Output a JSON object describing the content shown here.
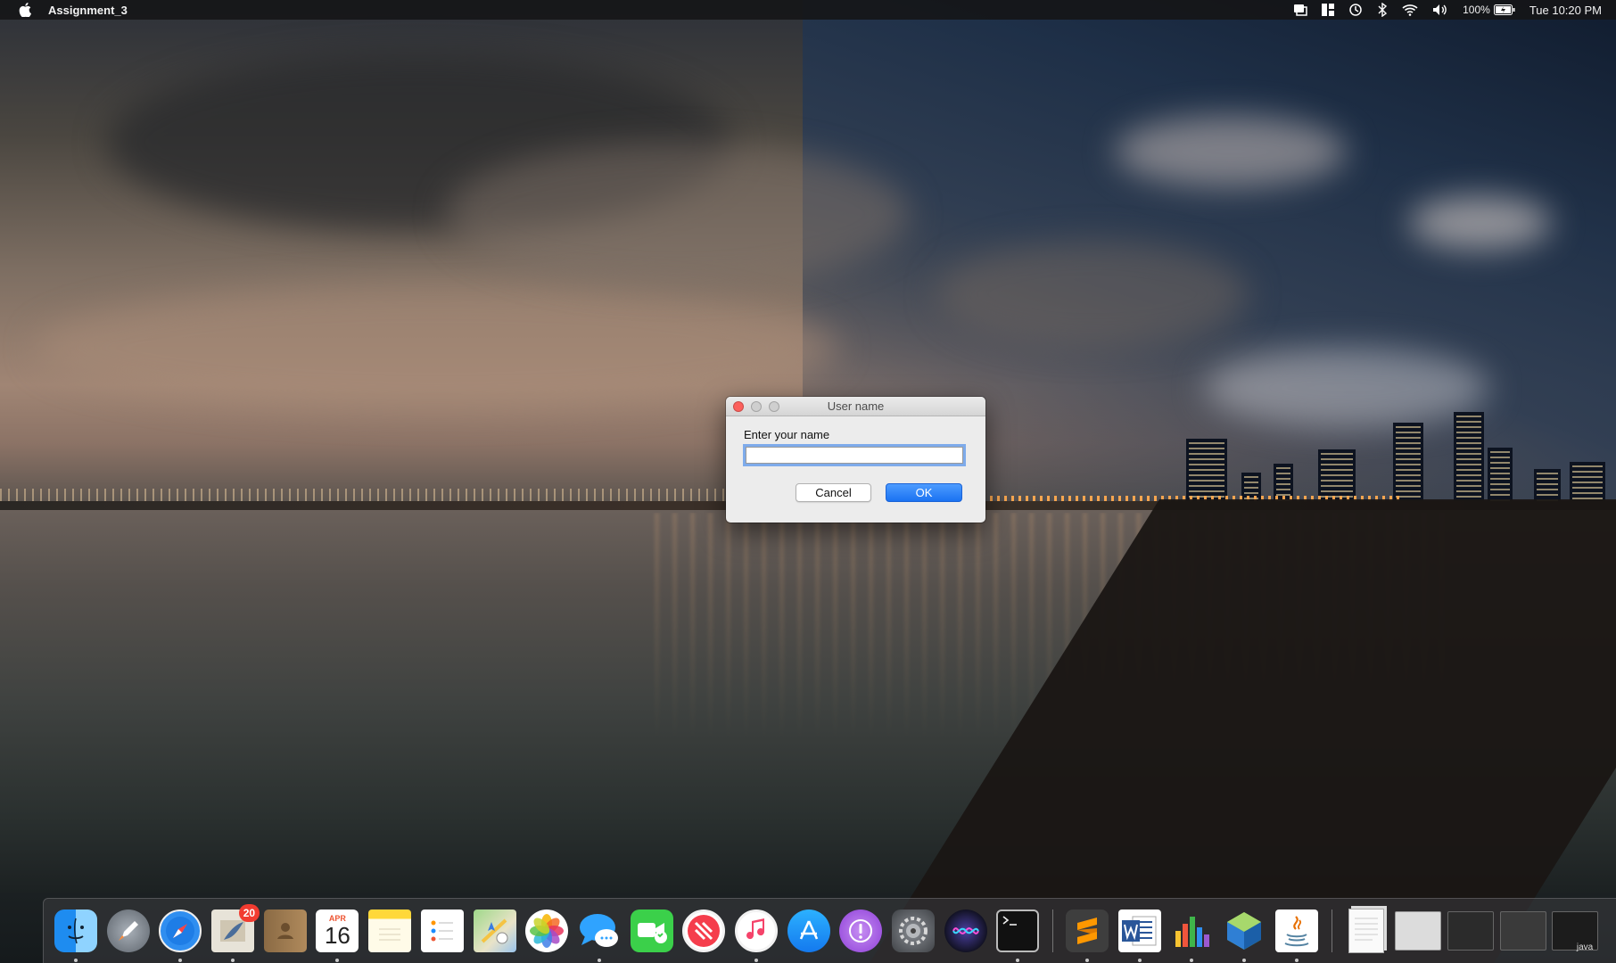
{
  "menubar": {
    "app_name": "Assignment_3",
    "battery_text": "100%",
    "clock": "Tue 10:20 PM",
    "icons": [
      "apple-icon",
      "notification-icon",
      "dashboard-icon",
      "time-machine-icon",
      "bluetooth-icon",
      "wifi-icon",
      "volume-icon",
      "battery-icon"
    ]
  },
  "dialog": {
    "title": "User name",
    "prompt": "Enter your name",
    "input_value": "",
    "cancel_label": "Cancel",
    "ok_label": "OK"
  },
  "dock": {
    "apps": [
      {
        "name": "Finder",
        "icon": "finder-icon",
        "running": true
      },
      {
        "name": "Launchpad",
        "icon": "launchpad-icon",
        "running": false
      },
      {
        "name": "Safari",
        "icon": "safari-icon",
        "running": true
      },
      {
        "name": "Mail",
        "icon": "mail-icon",
        "running": true,
        "badge": "20"
      },
      {
        "name": "Contacts",
        "icon": "contacts-icon",
        "running": false
      },
      {
        "name": "Calendar",
        "icon": "calendar-icon",
        "running": true,
        "month": "APR",
        "day": "16"
      },
      {
        "name": "Notes",
        "icon": "notes-icon",
        "running": false
      },
      {
        "name": "Reminders",
        "icon": "reminders-icon",
        "running": false
      },
      {
        "name": "Maps",
        "icon": "maps-icon",
        "running": false
      },
      {
        "name": "Photos",
        "icon": "photos-icon",
        "running": false
      },
      {
        "name": "Messages",
        "icon": "messages-icon",
        "running": true
      },
      {
        "name": "FaceTime",
        "icon": "facetime-icon",
        "running": false
      },
      {
        "name": "News",
        "icon": "news-icon",
        "running": false
      },
      {
        "name": "iTunes",
        "icon": "itunes-icon",
        "running": true
      },
      {
        "name": "App Store",
        "icon": "app-store-icon",
        "running": false
      },
      {
        "name": "Feedback Assistant",
        "icon": "feedback-icon",
        "running": false
      },
      {
        "name": "System Preferences",
        "icon": "system-preferences-icon",
        "running": false
      },
      {
        "name": "Siri",
        "icon": "siri-icon",
        "running": false
      },
      {
        "name": "Terminal",
        "icon": "terminal-icon",
        "running": true
      }
    ],
    "apps2": [
      {
        "name": "Sublime Text",
        "icon": "sublime-icon",
        "running": true
      },
      {
        "name": "Microsoft Word",
        "icon": "word-icon",
        "running": true
      },
      {
        "name": "Numbers",
        "icon": "numbers-icon",
        "running": true
      },
      {
        "name": "NetBeans",
        "icon": "netbeans-icon",
        "running": true
      },
      {
        "name": "Java",
        "icon": "java-icon",
        "running": true
      }
    ],
    "minimized_label": "java"
  }
}
